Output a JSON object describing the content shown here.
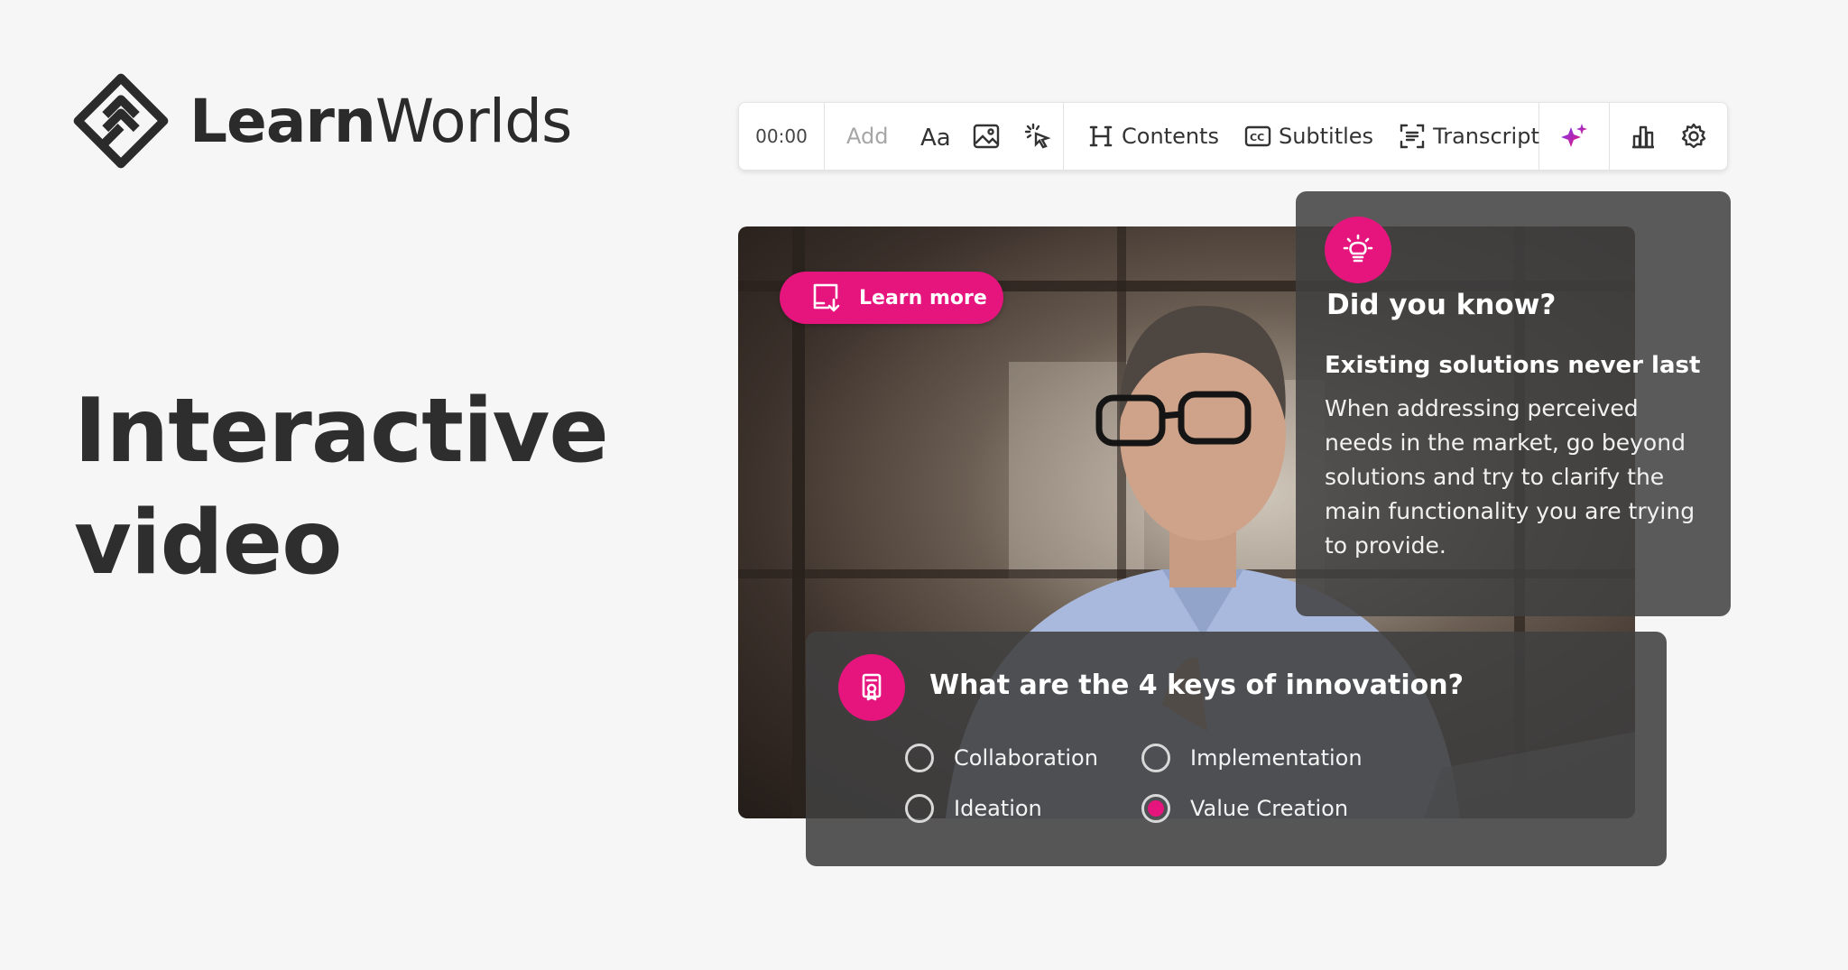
{
  "brand": {
    "bold": "Learn",
    "light": "Worlds",
    "accent": "#e5157d"
  },
  "headline": {
    "line1": "Interactive",
    "line2": "video"
  },
  "toolbar": {
    "time": "00:00",
    "add_label": "Add",
    "add_tools": [
      {
        "name": "text-tool",
        "icon": "text-icon"
      },
      {
        "name": "image-tool",
        "icon": "image-icon"
      },
      {
        "name": "hotspot-tool",
        "icon": "click-icon"
      }
    ],
    "contents_label": "Contents",
    "subtitles_label": "Subtitles",
    "transcript_label": "Transcript"
  },
  "learn_more": {
    "label": "Learn more"
  },
  "did_you_know": {
    "title": "Did you know?",
    "subtitle": "Existing solutions never last",
    "body": "When addressing perceived needs in the market, go beyond solutions and try to clarify the main functionality you are trying to provide."
  },
  "quiz": {
    "question": "What are the 4 keys of innovation?",
    "options": [
      {
        "label": "Collaboration",
        "selected": false
      },
      {
        "label": "Implementation",
        "selected": false
      },
      {
        "label": "Ideation",
        "selected": false
      },
      {
        "label": "Value Creation",
        "selected": true
      }
    ]
  }
}
